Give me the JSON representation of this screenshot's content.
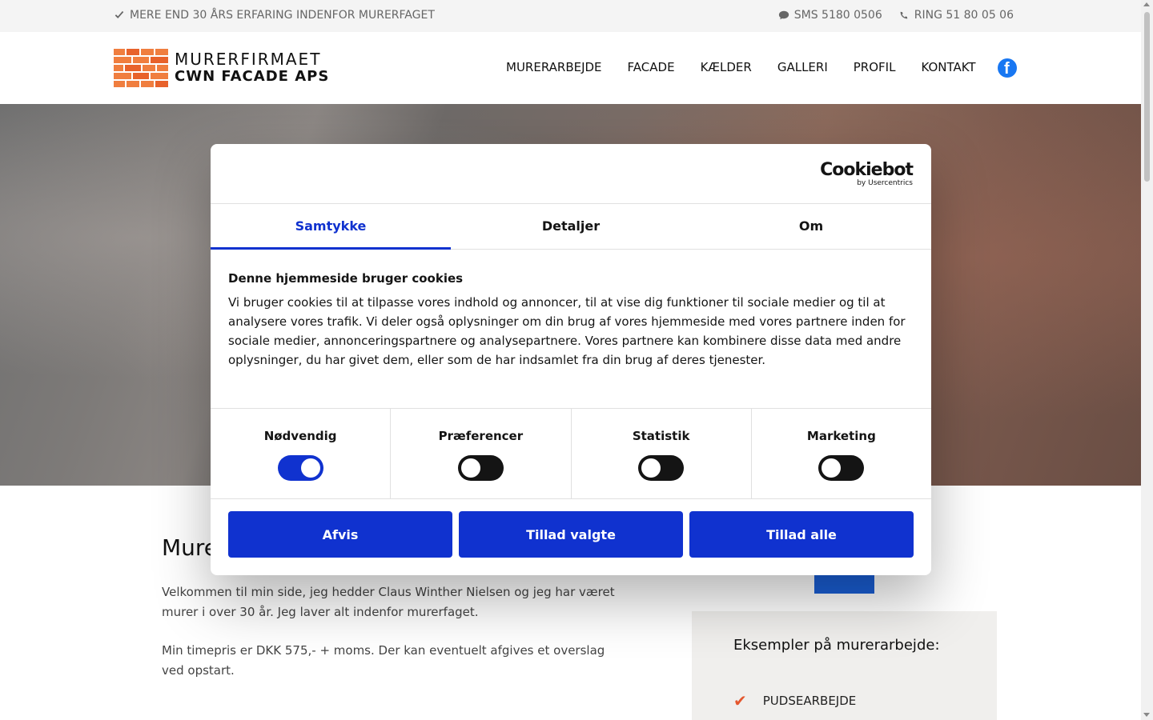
{
  "topbar": {
    "tagline": "MERE END 30 ÅRS ERFARING INDENFOR MURERFAGET",
    "sms": "SMS 5180 0506",
    "phone": "RING 51 80 05 06"
  },
  "logo": {
    "line1": "MURERFIRMAET",
    "line2": "CWN FACADE APS"
  },
  "nav": [
    "MURERARBEJDE",
    "FACADE",
    "KÆLDER",
    "GALLERI",
    "PROFIL",
    "KONTAKT"
  ],
  "content": {
    "title": "Mure",
    "p1": "Velkommen til min side, jeg hedder Claus Winther Nielsen og jeg har været murer i over 30 år. Jeg laver alt indenfor murerfaget.",
    "p2": "Min timepris er DKK 575,- + moms. Der kan eventuelt afgives et overslag ved opstart."
  },
  "sidebox": {
    "title": "Eksempler på murerarbejde:",
    "items": [
      "PUDSEARBEJDE"
    ]
  },
  "cookie": {
    "brand": "Cookiebot",
    "brand_sub": "by Usercentrics",
    "tabs": [
      "Samtykke",
      "Detaljer",
      "Om"
    ],
    "active_tab": "Samtykke",
    "heading": "Denne hjemmeside bruger cookies",
    "description": "Vi bruger cookies til at tilpasse vores indhold og annoncer, til at vise dig funktioner til sociale medier og til at analysere vores trafik. Vi deler også oplysninger om din brug af vores hjemmeside med vores partnere inden for sociale medier, annonceringspartnere og analysepartnere. Vores partnere kan kombinere disse data med andre oplysninger, du har givet dem, eller som de har indsamlet fra din brug af deres tjenester.",
    "categories": [
      {
        "label": "Nødvendig",
        "enabled": true
      },
      {
        "label": "Præferencer",
        "enabled": false
      },
      {
        "label": "Statistik",
        "enabled": false
      },
      {
        "label": "Marketing",
        "enabled": false
      }
    ],
    "buttons": [
      "Afvis",
      "Tillad valgte",
      "Tillad alle"
    ],
    "accent_color": "#1032cf"
  },
  "colors": {
    "facebook": "#1877f2",
    "check": "#e4572e"
  }
}
